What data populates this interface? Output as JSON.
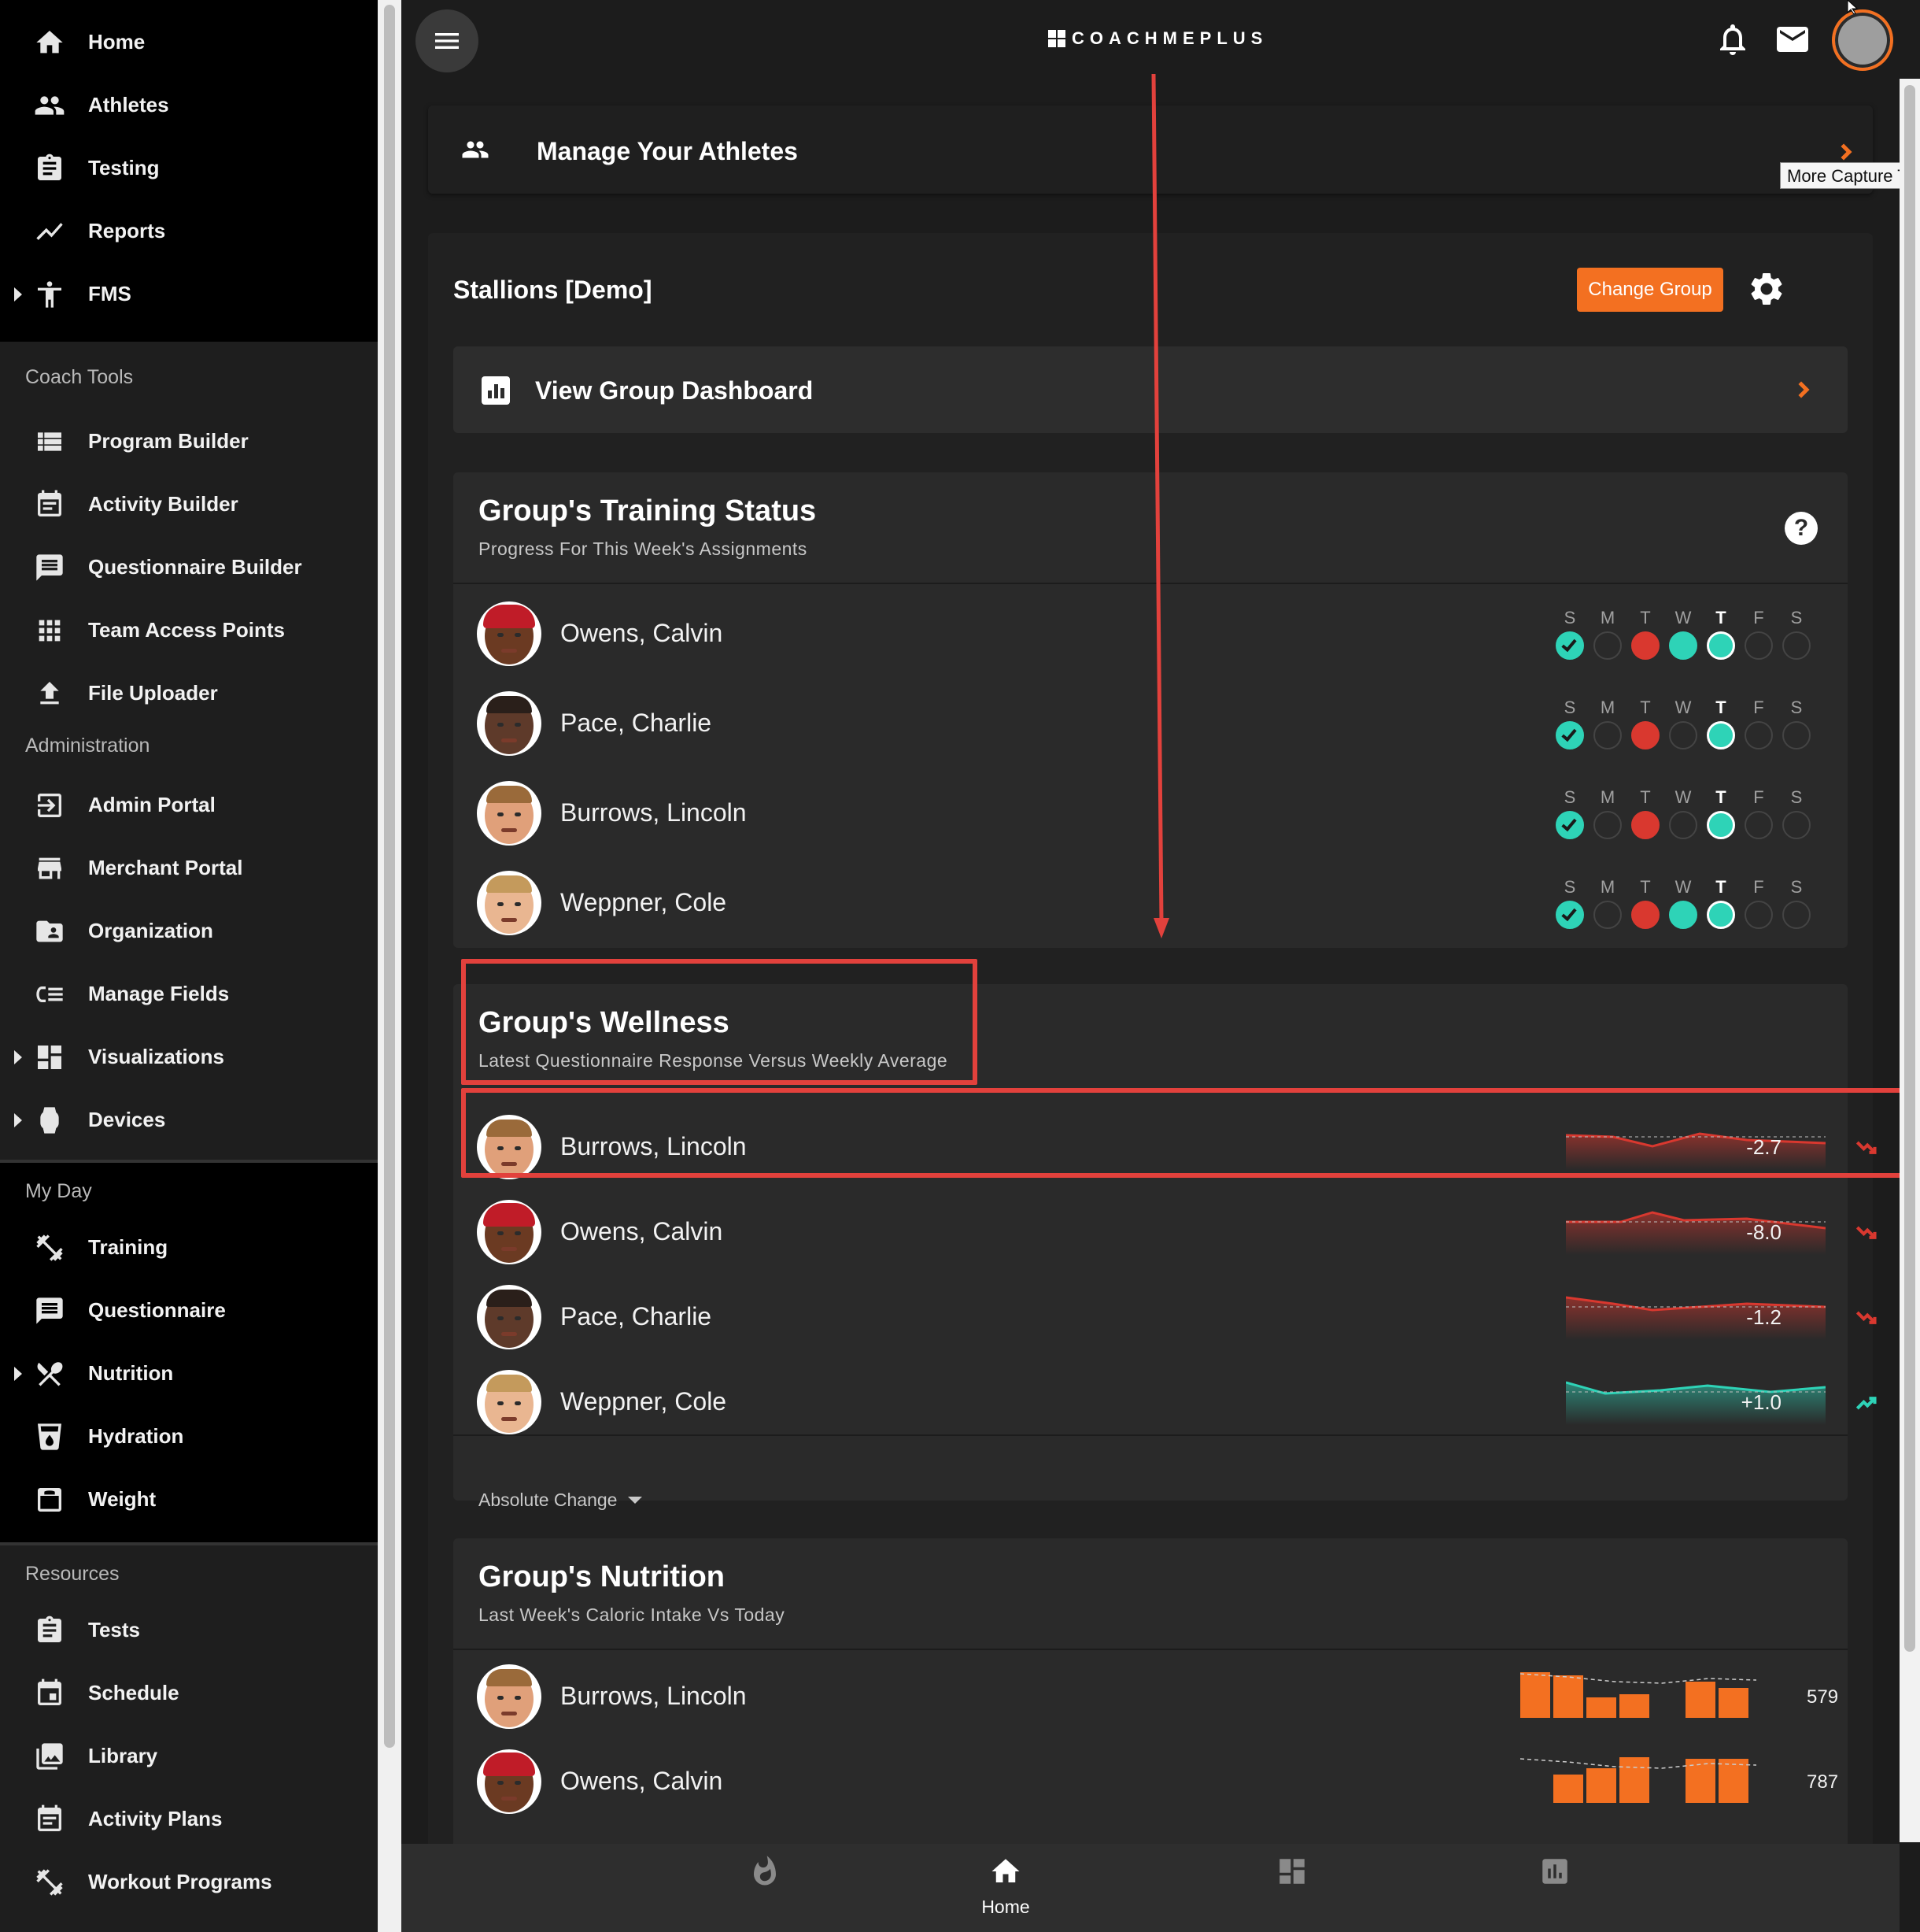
{
  "sidebar": {
    "primary": [
      {
        "label": "Home",
        "icon": "home-icon"
      },
      {
        "label": "Athletes",
        "icon": "athletes-icon"
      },
      {
        "label": "Testing",
        "icon": "clipboard-icon"
      },
      {
        "label": "Reports",
        "icon": "line-chart-icon"
      },
      {
        "label": "FMS",
        "icon": "figure-icon",
        "expandable": true
      }
    ],
    "coach_tools": {
      "header": "Coach Tools",
      "items": [
        {
          "label": "Program Builder",
          "icon": "list-icon"
        },
        {
          "label": "Activity Builder",
          "icon": "calendar-list-icon"
        },
        {
          "label": "Questionnaire Builder",
          "icon": "chat-list-icon"
        },
        {
          "label": "Team Access Points",
          "icon": "grid-icon"
        },
        {
          "label": "File Uploader",
          "icon": "upload-icon"
        }
      ]
    },
    "administration": {
      "header": "Administration",
      "items": [
        {
          "label": "Admin Portal",
          "icon": "login-icon"
        },
        {
          "label": "Merchant Portal",
          "icon": "store-icon"
        },
        {
          "label": "Organization",
          "icon": "folder-user-icon"
        },
        {
          "label": "Manage Fields",
          "icon": "fields-icon"
        },
        {
          "label": "Visualizations",
          "icon": "dashboard-icon",
          "expandable": true
        },
        {
          "label": "Devices",
          "icon": "watch-icon",
          "expandable": true
        }
      ]
    },
    "my_day": {
      "header": "My Day",
      "items": [
        {
          "label": "Training",
          "icon": "dumbbell-icon"
        },
        {
          "label": "Questionnaire",
          "icon": "chat-icon"
        },
        {
          "label": "Nutrition",
          "icon": "utensils-icon",
          "expandable": true
        },
        {
          "label": "Hydration",
          "icon": "cup-icon"
        },
        {
          "label": "Weight",
          "icon": "scale-icon"
        }
      ]
    },
    "resources": {
      "header": "Resources",
      "items": [
        {
          "label": "Tests",
          "icon": "clipboard-icon"
        },
        {
          "label": "Schedule",
          "icon": "calendar-icon"
        },
        {
          "label": "Library",
          "icon": "image-library-icon"
        },
        {
          "label": "Activity Plans",
          "icon": "calendar-list-icon"
        },
        {
          "label": "Workout Programs",
          "icon": "dumbbell-icon"
        }
      ]
    }
  },
  "header": {
    "logo_text": "COACHMEPLUS",
    "icons": [
      "menu-icon",
      "bell-icon",
      "mail-icon",
      "profile-avatar"
    ]
  },
  "manage": {
    "title": "Manage Your Athletes",
    "tooltip": "More Capture Ty"
  },
  "group": {
    "name": "Stallions [Demo]",
    "change_label": "Change Group",
    "dashboard_label": "View Group Dashboard"
  },
  "training": {
    "title": "Group's Training Status",
    "subtitle": "Progress For This Week's Assignments",
    "help": "?",
    "days": [
      "S",
      "M",
      "T",
      "W",
      "T",
      "F",
      "S"
    ],
    "today_index": 4,
    "athletes": [
      {
        "name": "Owens, Calvin",
        "face": "calvin",
        "status": [
          "done",
          "none",
          "miss",
          "done",
          "done",
          "none",
          "none"
        ]
      },
      {
        "name": "Pace, Charlie",
        "face": "charlie",
        "status": [
          "done",
          "none",
          "miss",
          "none",
          "done",
          "none",
          "none"
        ]
      },
      {
        "name": "Burrows, Lincoln",
        "face": "lincoln",
        "status": [
          "done",
          "none",
          "miss",
          "none",
          "done",
          "none",
          "none"
        ]
      },
      {
        "name": "Weppner, Cole",
        "face": "cole",
        "status": [
          "done",
          "none",
          "miss",
          "done",
          "done",
          "none",
          "none"
        ]
      }
    ]
  },
  "wellness": {
    "title": "Group's Wellness",
    "subtitle": "Latest Questionnaire Response Versus Weekly Average",
    "mode_label": "Absolute Change",
    "athletes": [
      {
        "name": "Burrows, Lincoln",
        "face": "lincoln",
        "value": "-2.7",
        "trend": "down"
      },
      {
        "name": "Owens, Calvin",
        "face": "calvin",
        "value": "-8.0",
        "trend": "down"
      },
      {
        "name": "Pace, Charlie",
        "face": "charlie",
        "value": "-1.2",
        "trend": "down"
      },
      {
        "name": "Weppner, Cole",
        "face": "cole",
        "value": "+1.0",
        "trend": "up"
      }
    ]
  },
  "nutrition": {
    "title": "Group's Nutrition",
    "subtitle": "Last Week's Caloric Intake Vs Today",
    "athletes": [
      {
        "name": "Burrows, Lincoln",
        "face": "lincoln",
        "value": "579"
      },
      {
        "name": "Owens, Calvin",
        "face": "calvin",
        "value": "787"
      }
    ]
  },
  "bottom_nav": [
    {
      "label": "",
      "icon": "flame-icon"
    },
    {
      "label": "Home",
      "icon": "home-icon"
    },
    {
      "label": "",
      "icon": "dashboard-icon"
    },
    {
      "label": "",
      "icon": "bar-chart-icon"
    }
  ],
  "colors": {
    "accent": "#f37021",
    "done": "#2ed3b7",
    "missed": "#d9382f",
    "annotation": "#e2413c"
  }
}
